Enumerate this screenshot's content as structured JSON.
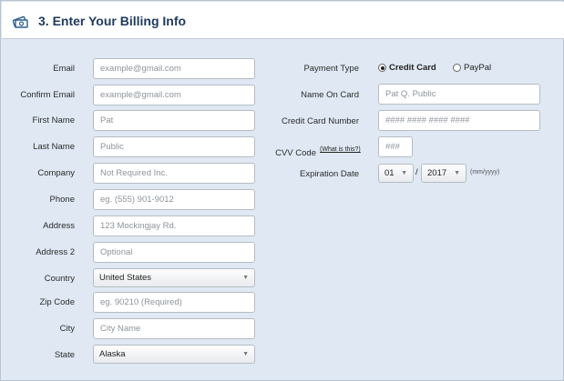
{
  "header": {
    "title": "3. Enter Your Billing Info",
    "icon": "money-icon"
  },
  "left_fields": [
    {
      "label": "Email",
      "placeholder": "example@gmail.com"
    },
    {
      "label": "Confirm Email",
      "placeholder": "example@gmail.com"
    },
    {
      "label": "First Name",
      "placeholder": "Pat"
    },
    {
      "label": "Last Name",
      "placeholder": "Public"
    },
    {
      "label": "Company",
      "placeholder": "Not Required Inc."
    },
    {
      "label": "Phone",
      "placeholder": "eg. (555) 901-9012"
    },
    {
      "label": "Address",
      "placeholder": "123 Mockingjay Rd."
    },
    {
      "label": "Address 2",
      "placeholder": "Optional"
    },
    {
      "label": "Country",
      "value": "United States"
    },
    {
      "label": "Zip Code",
      "placeholder": "eg. 90210 (Required)"
    },
    {
      "label": "City",
      "placeholder": "City Name"
    },
    {
      "label": "State",
      "value": "Alaska"
    }
  ],
  "payment": {
    "label": "Payment Type",
    "option_credit": "Credit Card",
    "option_paypal": "PayPal",
    "selected": "Credit Card"
  },
  "name_on_card": {
    "label": "Name On Card",
    "placeholder": "Pat Q. Public"
  },
  "card_number": {
    "label": "Credit Card Number",
    "placeholder": "#### #### #### ####"
  },
  "cvv": {
    "label": "CVV Code",
    "help_link": "(What is this?)",
    "placeholder": "###"
  },
  "expiration": {
    "label": "Expiration Date",
    "month": "01",
    "separator": "/",
    "year": "2017",
    "hint": "(mm/yyyy)"
  }
}
